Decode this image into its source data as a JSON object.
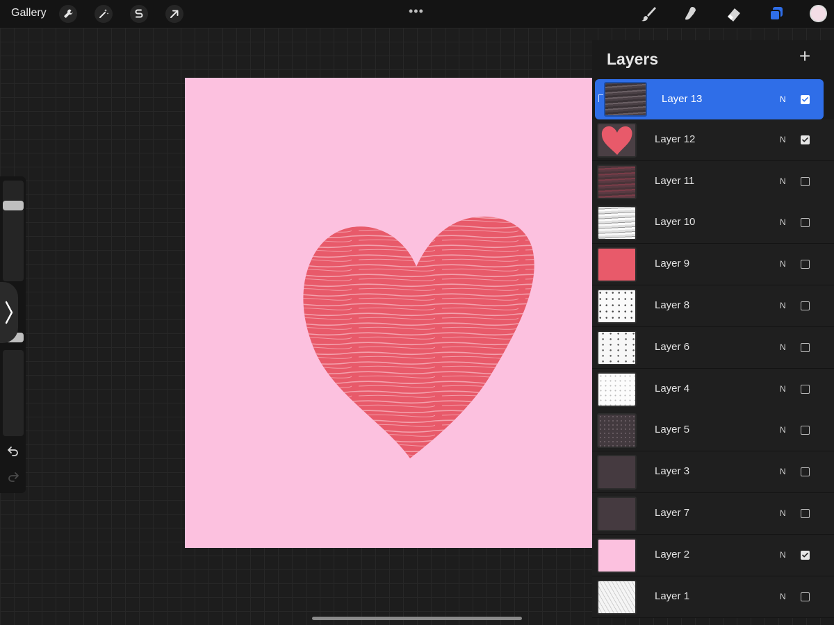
{
  "topbar": {
    "gallery_label": "Gallery",
    "more_label": "•••",
    "left_tools": [
      "wrench-icon",
      "magic-wand-icon",
      "selection-icon",
      "transform-arrow-icon"
    ],
    "right_tools": [
      "brush-icon",
      "smudge-icon",
      "eraser-icon",
      "layers-icon"
    ],
    "accent": "#2f6ee8",
    "current_color": "#f3dde6"
  },
  "canvas": {
    "background_color": "#fcc1df",
    "heart_color": "#e85a6a"
  },
  "layers": {
    "title": "Layers",
    "add_label": "+",
    "items": [
      {
        "name": "Layer 13",
        "blend": "N",
        "visible": true,
        "selected": true,
        "thumb": "dark-texture"
      },
      {
        "name": "Layer 12",
        "blend": "N",
        "visible": true,
        "selected": false,
        "thumb": "heart"
      },
      {
        "name": "Layer 11",
        "blend": "N",
        "visible": false,
        "selected": false,
        "thumb": "red-texture"
      },
      {
        "name": "Layer 10",
        "blend": "N",
        "visible": false,
        "selected": false,
        "thumb": "gray-texture"
      },
      {
        "name": "Layer 9",
        "blend": "N",
        "visible": false,
        "selected": false,
        "thumb": "red-solid"
      },
      {
        "name": "Layer 8",
        "blend": "N",
        "visible": false,
        "selected": false,
        "thumb": "white-speckle"
      },
      {
        "name": "Layer 6",
        "blend": "N",
        "visible": false,
        "selected": false,
        "thumb": "white-scratch"
      },
      {
        "name": "Layer 4",
        "blend": "N",
        "visible": false,
        "selected": false,
        "thumb": "white-light"
      },
      {
        "name": "Layer 5",
        "blend": "N",
        "visible": false,
        "selected": false,
        "thumb": "dark-speckle"
      },
      {
        "name": "Layer 3",
        "blend": "N",
        "visible": false,
        "selected": false,
        "thumb": "dark-plain"
      },
      {
        "name": "Layer 7",
        "blend": "N",
        "visible": false,
        "selected": false,
        "thumb": "dark-plain"
      },
      {
        "name": "Layer 2",
        "blend": "N",
        "visible": true,
        "selected": false,
        "thumb": "pink-solid"
      },
      {
        "name": "Layer 1",
        "blend": "N",
        "visible": false,
        "selected": false,
        "thumb": "white-sketch"
      }
    ]
  }
}
